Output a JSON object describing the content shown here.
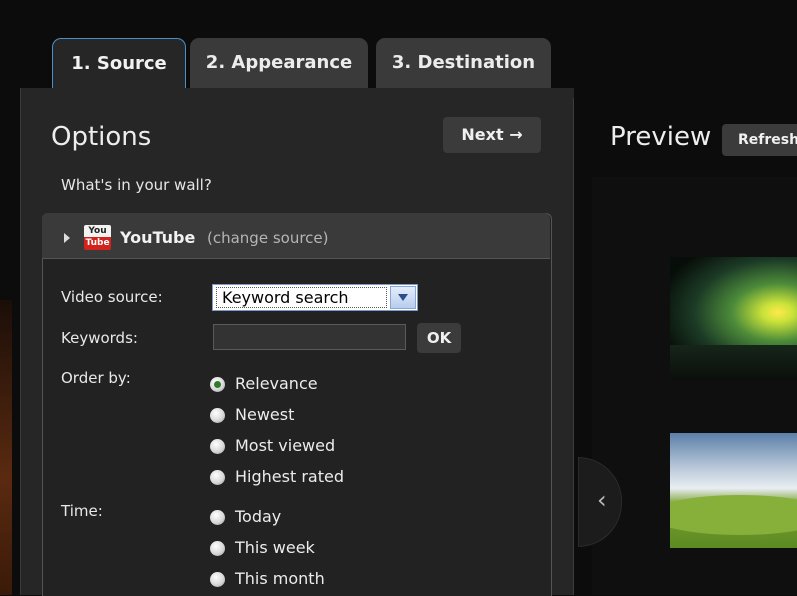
{
  "tabs": [
    {
      "label": "1. Source",
      "active": true
    },
    {
      "label": "2. Appearance",
      "active": false
    },
    {
      "label": "3. Destination",
      "active": false
    }
  ],
  "options": {
    "title": "Options",
    "next_label": "Next",
    "next_arrow": "→",
    "question": "What's in your wall?"
  },
  "source": {
    "logo_top": "You",
    "logo_bottom": "Tube",
    "name": "YouTube",
    "change_label": "(change source)"
  },
  "form": {
    "video_source_label": "Video source:",
    "video_source_value": "Keyword search",
    "keywords_label": "Keywords:",
    "keywords_value": "",
    "ok_label": "OK",
    "order_by_label": "Order by:",
    "order_options": [
      "Relevance",
      "Newest",
      "Most viewed",
      "Highest rated"
    ],
    "order_selected": "Relevance",
    "time_label": "Time:",
    "time_options": [
      "Today",
      "This week",
      "This month"
    ]
  },
  "preview": {
    "title": "Preview",
    "refresh_label": "Refresh",
    "prev_icon": "‹"
  },
  "colors": {
    "background": "#0c0c0c",
    "panel": "#262626",
    "tab_active_border": "#4a90c8",
    "youtube_red": "#d0241c"
  }
}
